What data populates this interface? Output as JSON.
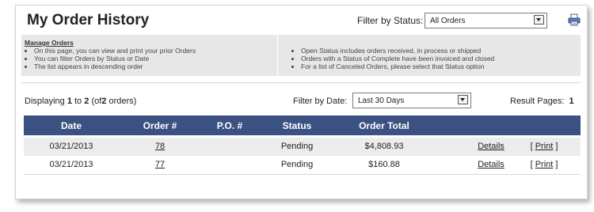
{
  "header": {
    "title": "My Order History",
    "filter_status_label": "Filter by Status:",
    "status_value": "All Orders"
  },
  "info": {
    "heading": "Manage Orders",
    "left_items": [
      "On this page, you can view and print your prior Orders",
      "You can filter Orders by Status or Date",
      "The list appears in descending order"
    ],
    "right_items": [
      "Open Status includes orders received, in process or shipped",
      "Orders with a Status of Complete have been invoiced and closed",
      "For a list of Canceled Orders, please select that Status option"
    ]
  },
  "toolbar": {
    "displaying": "Displaying",
    "from": "1",
    "to_word": "to",
    "to": "2",
    "of_text": "(of",
    "total": "2",
    "orders_suffix": "orders)",
    "filter_date_label": "Filter by Date:",
    "date_value": "Last 30 Days",
    "result_pages_label": "Result Pages:",
    "result_page": "1"
  },
  "table": {
    "columns": [
      "Date",
      "Order #",
      "P.O. #",
      "Status",
      "Order Total"
    ],
    "rows": [
      {
        "date": "03/21/2013",
        "order": "78",
        "po": "",
        "status": "Pending",
        "total": "$4,808.93",
        "details": "Details",
        "print_open": "[",
        "print": "Print",
        "print_close": "]"
      },
      {
        "date": "03/21/2013",
        "order": "77",
        "po": "",
        "status": "Pending",
        "total": "$160.88",
        "details": "Details",
        "print_open": "[",
        "print": "Print",
        "print_close": "]"
      }
    ]
  },
  "icons": {
    "print": "printer-icon"
  },
  "colors": {
    "header_bg": "#3b5182",
    "info_bg": "#e7e7e7",
    "row_alt": "#ececec"
  }
}
